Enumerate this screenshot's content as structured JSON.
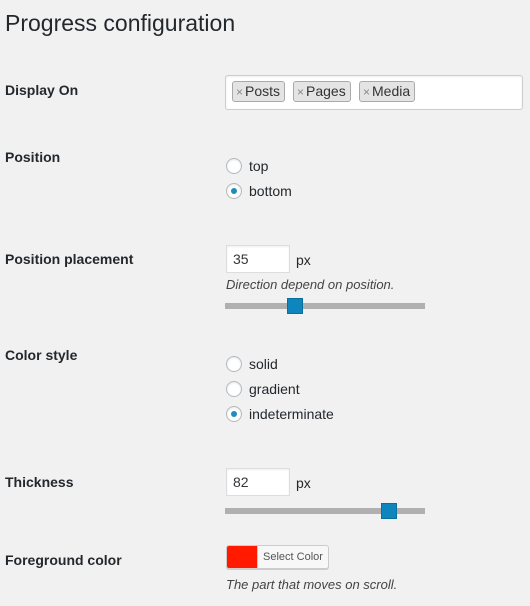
{
  "page": {
    "title": "Progress configuration"
  },
  "display_on": {
    "label": "Display On",
    "tokens": [
      "Posts",
      "Pages",
      "Media"
    ],
    "remove_glyph": "×"
  },
  "position": {
    "label": "Position",
    "options": [
      "top",
      "bottom"
    ],
    "selected": "bottom"
  },
  "position_placement": {
    "label": "Position placement",
    "value": "35",
    "unit": "px",
    "description": "Direction depend on position.",
    "slider_fraction": 0.35
  },
  "color_style": {
    "label": "Color style",
    "options": [
      "solid",
      "gradient",
      "indeterminate"
    ],
    "selected": "indeterminate"
  },
  "thickness": {
    "label": "Thickness",
    "value": "82",
    "unit": "px",
    "slider_fraction": 0.82
  },
  "foreground_color": {
    "label": "Foreground color",
    "button_label": "Select Color",
    "color": "#ff1a00",
    "description": "The part that moves on scroll."
  },
  "colors": {
    "accent": "#0e86bd",
    "radio_checked": "#1e8cbe"
  }
}
